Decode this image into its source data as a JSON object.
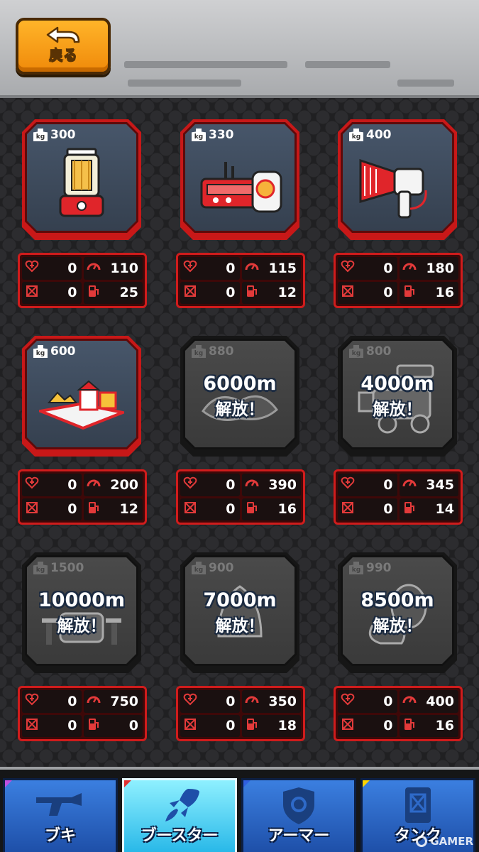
{
  "header": {
    "back_label": "戻る"
  },
  "items": [
    {
      "weight": "300",
      "locked": false,
      "unlock_distance": "",
      "unlock_text": "",
      "art": "stove",
      "stats": {
        "health": "0",
        "speed": "110",
        "armor": "0",
        "fuel": "25"
      }
    },
    {
      "weight": "330",
      "locked": false,
      "unlock_distance": "",
      "unlock_text": "",
      "art": "gas-burner",
      "stats": {
        "health": "0",
        "speed": "115",
        "armor": "0",
        "fuel": "12"
      }
    },
    {
      "weight": "400",
      "locked": false,
      "unlock_distance": "",
      "unlock_text": "",
      "art": "megaphone",
      "stats": {
        "health": "0",
        "speed": "180",
        "armor": "0",
        "fuel": "16"
      }
    },
    {
      "weight": "600",
      "locked": false,
      "unlock_distance": "",
      "unlock_text": "",
      "art": "pop-up-book",
      "stats": {
        "health": "0",
        "speed": "200",
        "armor": "0",
        "fuel": "12"
      }
    },
    {
      "weight": "880",
      "locked": true,
      "unlock_distance": "6000m",
      "unlock_text": "解放！",
      "art": "locked-booster",
      "stats": {
        "health": "0",
        "speed": "390",
        "armor": "0",
        "fuel": "16"
      }
    },
    {
      "weight": "800",
      "locked": true,
      "unlock_distance": "4000m",
      "unlock_text": "解放！",
      "art": "locked-cannon",
      "stats": {
        "health": "0",
        "speed": "345",
        "armor": "0",
        "fuel": "14"
      }
    },
    {
      "weight": "1500",
      "locked": true,
      "unlock_distance": "10000m",
      "unlock_text": "解放！",
      "art": "locked-fountain",
      "stats": {
        "health": "0",
        "speed": "750",
        "armor": "0",
        "fuel": "0"
      }
    },
    {
      "weight": "900",
      "locked": true,
      "unlock_distance": "7000m",
      "unlock_text": "解放！",
      "art": "locked-iron",
      "stats": {
        "health": "0",
        "speed": "350",
        "armor": "0",
        "fuel": "18"
      }
    },
    {
      "weight": "990",
      "locked": true,
      "unlock_distance": "8500m",
      "unlock_text": "解放！",
      "art": "locked-fan",
      "stats": {
        "health": "0",
        "speed": "400",
        "armor": "0",
        "fuel": "16"
      }
    }
  ],
  "tabs": [
    {
      "label": "ブキ",
      "active": false,
      "icon": "gun-icon"
    },
    {
      "label": "ブースター",
      "active": true,
      "icon": "rocket-icon"
    },
    {
      "label": "アーマー",
      "active": false,
      "icon": "shield-gear-icon"
    },
    {
      "label": "タンク",
      "active": false,
      "icon": "fuel-tank-icon"
    }
  ],
  "watermark": "GAMER",
  "colors": {
    "accent": "#d01c1c",
    "back_button": "#f5960f",
    "tab_active": "#5fd6f5",
    "tab_inactive": "#2e6ac9"
  }
}
